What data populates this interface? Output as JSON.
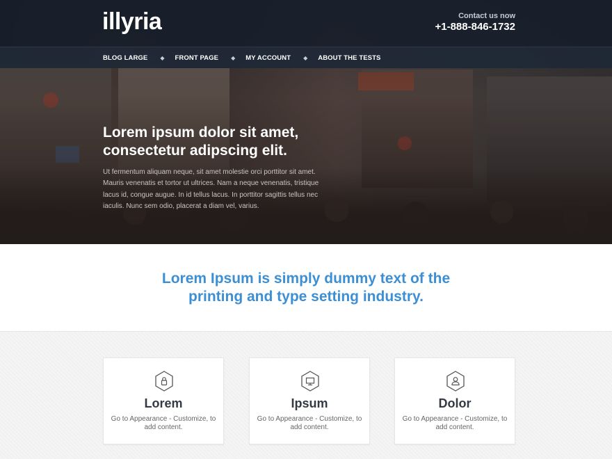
{
  "site": {
    "logo": "illyria",
    "contact_label": "Contact us now",
    "phone": "+1-888-846-1732"
  },
  "nav": {
    "items": [
      {
        "label": "BLOG LARGE"
      },
      {
        "label": "FRONT PAGE"
      },
      {
        "label": "MY ACCOUNT"
      },
      {
        "label": "ABOUT THE TESTS"
      }
    ],
    "separator": "◆"
  },
  "hero": {
    "title_line1": "Lorem ipsum dolor sit amet,",
    "title_line2": "consectetur adipscing elit.",
    "body": "Ut fermentum aliquam neque, sit amet molestie orci porttitor sit amet. Mauris venenatis et tortor ut ultrices. Nam a neque venenatis, tristique lacus id, congue augue. In id tellus lacus. In porttitor sagittis tellus nec iaculis. Nunc sem odio, placerat a diam vel, varius."
  },
  "tagline": {
    "text": "Lorem Ipsum is simply dummy text of the printing and type setting industry."
  },
  "features": [
    {
      "icon": "lock-icon",
      "title": "Lorem",
      "text": "Go to Appearance - Customize, to add content."
    },
    {
      "icon": "monitor-icon",
      "title": "Ipsum",
      "text": "Go to Appearance - Customize, to add content."
    },
    {
      "icon": "user-icon",
      "title": "Dolor",
      "text": "Go to Appearance - Customize, to add content."
    }
  ],
  "colors": {
    "accent": "#3d8fd4",
    "header_bg": "#161e2a",
    "card_title": "#333a44"
  }
}
